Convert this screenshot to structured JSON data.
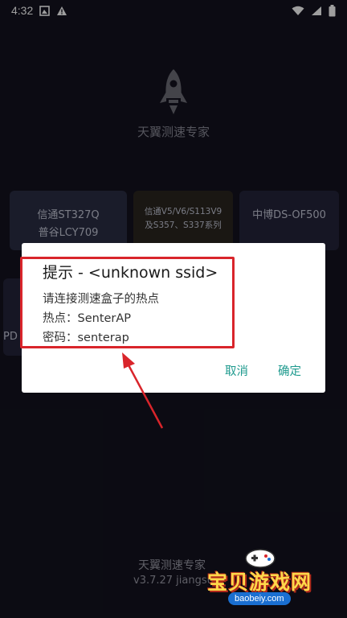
{
  "status_bar": {
    "time": "4:32",
    "left_icons": [
      "image-icon",
      "warning-icon"
    ],
    "right_icons": [
      "wifi-icon",
      "signal-icon",
      "battery-icon"
    ]
  },
  "app": {
    "name": "天翼测速专家",
    "icon": "rocket-icon"
  },
  "device_cards": [
    {
      "line1": "信通ST327Q",
      "line2": "普谷LCY709"
    },
    {
      "line1": "信通V5/V6/S113V9",
      "line2": "及S357、S337系列"
    },
    {
      "line1": "中博DS-OF500",
      "line2": ""
    },
    {
      "line1": "PD",
      "line2": ""
    }
  ],
  "dialog": {
    "title": "提示 - <unknown ssid>",
    "message": "请连接测速盒子的热点",
    "hotspot_line": "热点：SenterAP",
    "password_line": "密码：senterap",
    "cancel_label": "取消",
    "ok_label": "确定"
  },
  "footer": {
    "app_name": "天翼测速专家",
    "version": "v3.7.27 jiangsu"
  },
  "watermark": {
    "text": "宝贝游戏网",
    "url": "baobeiy.com"
  },
  "colors": {
    "background": "#14131f",
    "dialog_button": "#1e9a8e",
    "highlight": "#d9252b"
  }
}
